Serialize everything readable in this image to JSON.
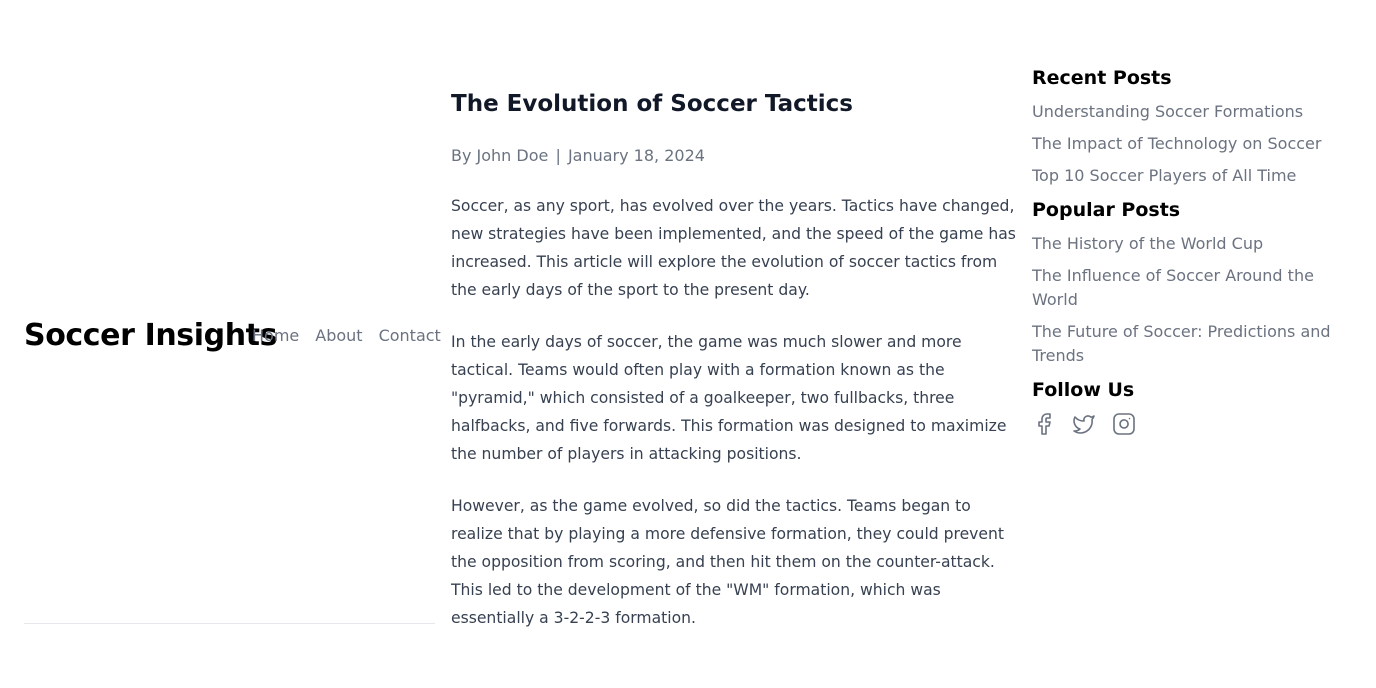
{
  "site": {
    "brand": "Soccer Insights",
    "nav": [
      "Home",
      "About",
      "Contact"
    ]
  },
  "article": {
    "title": "The Evolution of Soccer Tactics",
    "author": "By John Doe",
    "separator": "|",
    "date": "January 18, 2024",
    "paragraphs": [
      "Soccer, as any sport, has evolved over the years. Tactics have changed, new strategies have been implemented, and the speed of the game has increased. This article will explore the evolution of soccer tactics from the early days of the sport to the present day.",
      "In the early days of soccer, the game was much slower and more tactical. Teams would often play with a formation known as the \"pyramid,\" which consisted of a goalkeeper, two fullbacks, three halfbacks, and five forwards. This formation was designed to maximize the number of players in attacking positions.",
      "However, as the game evolved, so did the tactics. Teams began to realize that by playing a more defensive formation, they could prevent the opposition from scoring, and then hit them on the counter-attack. This led to the development of the \"WM\" formation, which was essentially a 3-2-2-3 formation."
    ]
  },
  "sidebar": {
    "recent": {
      "heading": "Recent Posts",
      "items": [
        "Understanding Soccer Formations",
        "The Impact of Technology on Soccer",
        "Top 10 Soccer Players of All Time"
      ]
    },
    "popular": {
      "heading": "Popular Posts",
      "items": [
        "The History of the World Cup",
        "The Influence of Soccer Around the World",
        "The Future of Soccer: Predictions and Trends"
      ]
    },
    "follow": {
      "heading": "Follow Us",
      "icons": [
        "facebook-icon",
        "twitter-icon",
        "instagram-icon"
      ]
    }
  },
  "colors": {
    "text_heading": "#111827",
    "text_body": "#374151",
    "text_muted": "#6b7280",
    "divider": "#e5e7eb"
  }
}
